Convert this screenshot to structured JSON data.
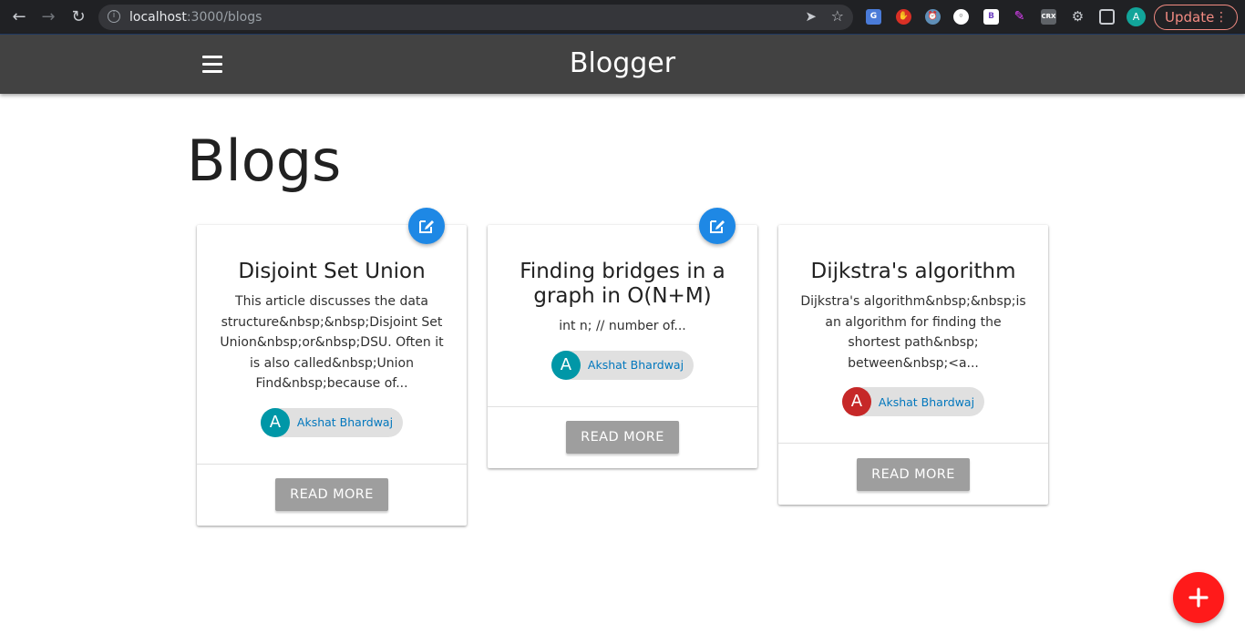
{
  "browser": {
    "url_host": "localhost",
    "url_rest": ":3000/blogs",
    "profile_initial": "A",
    "update_label": "Update",
    "extensions": [
      "G",
      "●",
      "◉",
      "(·)",
      "B",
      "✎",
      "CRX"
    ]
  },
  "appbar": {
    "title": "Blogger"
  },
  "page": {
    "heading": "Blogs"
  },
  "blogs": [
    {
      "title": "Disjoint Set Union",
      "description": "This article discusses the data structure&nbsp;&nbsp;Disjoint Set Union&nbsp;or&nbsp;DSU. Often it is also called&nbsp;Union Find&nbsp;because of...",
      "author": "Akshat Bhardwaj",
      "author_initial": "A",
      "avatar_color": "#0097a7",
      "editable": true,
      "action_label": "READ MORE"
    },
    {
      "title": "Finding bridges in a graph in O(N+M)",
      "description": "int n; // number of...",
      "author": "Akshat Bhardwaj",
      "author_initial": "A",
      "avatar_color": "#0097a7",
      "editable": true,
      "action_label": "READ MORE"
    },
    {
      "title": "Dijkstra's algorithm",
      "description": "Dijkstra's algorithm&nbsp;&nbsp;is an algorithm for finding the shortest path&nbsp; between&nbsp;<a...",
      "author": "Akshat Bhardwaj",
      "author_initial": "A",
      "avatar_color": "#c62828",
      "editable": false,
      "action_label": "READ MORE"
    }
  ],
  "colors": {
    "appbar": "#424242",
    "edit_fab": "#1e88e5",
    "add_fab": "#ff1a1a",
    "chip_text": "#0277bd",
    "button": "#9e9e9e"
  },
  "icons": {
    "edit_fab": "edit-icon",
    "add_fab": "plus-icon",
    "menu": "hamburger-icon"
  }
}
